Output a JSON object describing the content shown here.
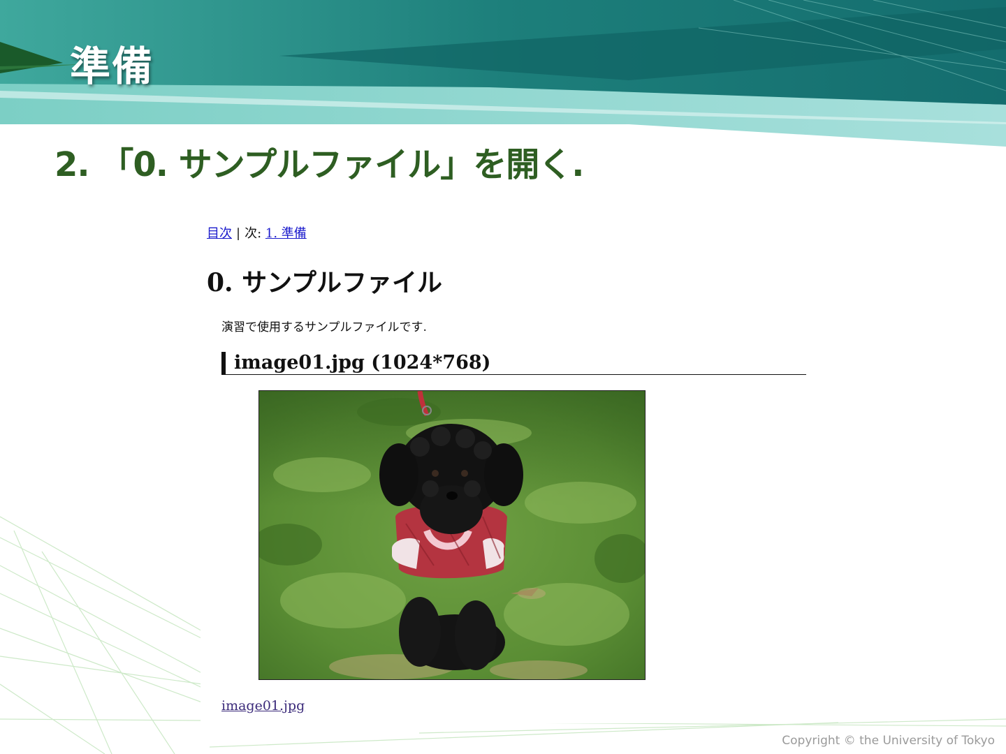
{
  "slide": {
    "title": "準備",
    "step_heading": "2. 「0. サンプルファイル」を開く.",
    "copyright": "Copyright © the University of Tokyo"
  },
  "browser": {
    "nav": {
      "toc_link": "目次",
      "separator": "|",
      "next_prefix": "次:",
      "next_link": "1. 準備"
    },
    "page_title": "0. サンプルファイル",
    "intro_text": "演習で使用するサンプルファイルです.",
    "file_heading": "image01.jpg (1024*768)",
    "image_alt": "黒いトイプードル",
    "file_link": "image01.jpg"
  },
  "colors": {
    "banner_teal": "#2a8b86",
    "heading_green": "#2e5e22",
    "link_blue": "#1a1acc",
    "visited_link": "#3b2a7a"
  }
}
